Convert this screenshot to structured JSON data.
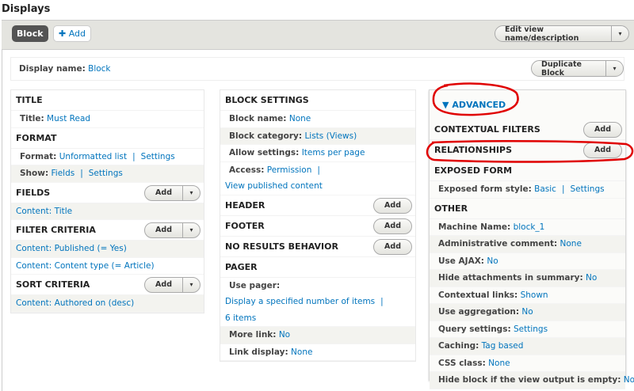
{
  "page_title": "Displays",
  "tabs": {
    "active": "Block",
    "add_plus": "✚",
    "add_label": "Add"
  },
  "edit_button": {
    "label": "Edit view name/description",
    "caret": "▾"
  },
  "display_name": {
    "label": "Display name:",
    "value": "Block"
  },
  "duplicate_button": {
    "label": "Duplicate Block",
    "caret": "▾"
  },
  "add_label": "Add",
  "advanced": {
    "arrow": "▼",
    "label": "ADVANCED"
  },
  "colors": {
    "link": "#0074bd",
    "annotation": "#e00000"
  },
  "columns": [
    {
      "sections": [
        {
          "title": "TITLE",
          "add": "none",
          "rows": [
            {
              "shade": false,
              "lines": [
                [
                  {
                    "k": "lab",
                    "t": "Title:"
                  },
                  {
                    "k": "lnk",
                    "t": "Must Read"
                  }
                ]
              ]
            }
          ]
        },
        {
          "title": "FORMAT",
          "add": "none",
          "rows": [
            {
              "shade": false,
              "lines": [
                [
                  {
                    "k": "lab",
                    "t": "Format:"
                  },
                  {
                    "k": "lnk",
                    "t": "Unformatted list"
                  },
                  {
                    "k": "sep",
                    "t": "|"
                  },
                  {
                    "k": "lnk",
                    "t": "Settings"
                  }
                ]
              ]
            },
            {
              "shade": true,
              "lines": [
                [
                  {
                    "k": "lab",
                    "t": "Show:"
                  },
                  {
                    "k": "lnk",
                    "t": "Fields"
                  },
                  {
                    "k": "sep",
                    "t": "|"
                  },
                  {
                    "k": "lnk",
                    "t": "Settings"
                  }
                ]
              ]
            }
          ]
        },
        {
          "title": "FIELDS",
          "add": "split",
          "rows": [
            {
              "shade": true,
              "lines": [
                [
                  {
                    "k": "lnk",
                    "t": "Content: Title"
                  }
                ]
              ]
            }
          ]
        },
        {
          "title": "FILTER CRITERIA",
          "add": "split",
          "rows": [
            {
              "shade": true,
              "lines": [
                [
                  {
                    "k": "lnk",
                    "t": "Content: Published (= Yes)"
                  }
                ]
              ]
            },
            {
              "shade": false,
              "lines": [
                [
                  {
                    "k": "lnk",
                    "t": "Content: Content type (= Article)"
                  }
                ]
              ]
            }
          ]
        },
        {
          "title": "SORT CRITERIA",
          "add": "split",
          "rows": [
            {
              "shade": true,
              "lines": [
                [
                  {
                    "k": "lnk",
                    "t": "Content: Authored on (desc)"
                  }
                ]
              ]
            }
          ]
        }
      ]
    },
    {
      "sections": [
        {
          "title": "BLOCK SETTINGS",
          "add": "none",
          "rows": [
            {
              "shade": false,
              "lines": [
                [
                  {
                    "k": "lab",
                    "t": "Block name:"
                  },
                  {
                    "k": "lnk",
                    "t": "None"
                  }
                ]
              ]
            },
            {
              "shade": true,
              "lines": [
                [
                  {
                    "k": "lab",
                    "t": "Block category:"
                  },
                  {
                    "k": "lnk",
                    "t": "Lists (Views)"
                  }
                ]
              ]
            },
            {
              "shade": false,
              "lines": [
                [
                  {
                    "k": "lab",
                    "t": "Allow settings:"
                  },
                  {
                    "k": "lnk",
                    "t": "Items per page"
                  }
                ]
              ]
            },
            {
              "shade": false,
              "lines": [
                [
                  {
                    "k": "lab",
                    "t": "Access:"
                  },
                  {
                    "k": "lnk",
                    "t": "Permission"
                  },
                  {
                    "k": "sep",
                    "t": "|"
                  }
                ],
                [
                  {
                    "k": "lnk",
                    "t": "View published content"
                  }
                ]
              ]
            }
          ]
        },
        {
          "title": "HEADER",
          "add": "simple",
          "rows": []
        },
        {
          "title": "FOOTER",
          "add": "simple",
          "rows": []
        },
        {
          "title": "NO RESULTS BEHAVIOR",
          "add": "simple",
          "rows": []
        },
        {
          "title": "PAGER",
          "add": "none",
          "rows": [
            {
              "shade": false,
              "lines": [
                [
                  {
                    "k": "lab",
                    "t": "Use pager:"
                  }
                ],
                [
                  {
                    "k": "lnk",
                    "t": "Display a specified number of items"
                  },
                  {
                    "k": "sep",
                    "t": "|"
                  }
                ],
                [
                  {
                    "k": "lnk",
                    "t": "6 items"
                  }
                ]
              ]
            },
            {
              "shade": true,
              "lines": [
                [
                  {
                    "k": "lab",
                    "t": "More link:"
                  },
                  {
                    "k": "lnk",
                    "t": "No"
                  }
                ]
              ]
            },
            {
              "shade": false,
              "lines": [
                [
                  {
                    "k": "lab",
                    "t": "Link display:"
                  },
                  {
                    "k": "lnk",
                    "t": "None"
                  }
                ]
              ]
            }
          ]
        }
      ]
    },
    {
      "sections": [
        {
          "title": "CONTEXTUAL FILTERS",
          "add": "simple",
          "rows": []
        },
        {
          "title": "RELATIONSHIPS",
          "add": "simple",
          "rows": []
        },
        {
          "title": "EXPOSED FORM",
          "add": "none",
          "rows": [
            {
              "shade": false,
              "lines": [
                [
                  {
                    "k": "lab",
                    "t": "Exposed form style:"
                  },
                  {
                    "k": "lnk",
                    "t": "Basic"
                  },
                  {
                    "k": "sep",
                    "t": "|"
                  },
                  {
                    "k": "lnk",
                    "t": "Settings"
                  }
                ]
              ]
            }
          ]
        },
        {
          "title": "OTHER",
          "add": "none",
          "rows": [
            {
              "shade": false,
              "lines": [
                [
                  {
                    "k": "lab",
                    "t": "Machine Name:"
                  },
                  {
                    "k": "lnk",
                    "t": "block_1"
                  }
                ]
              ]
            },
            {
              "shade": true,
              "lines": [
                [
                  {
                    "k": "lab",
                    "t": "Administrative comment:"
                  },
                  {
                    "k": "lnk",
                    "t": "None"
                  }
                ]
              ]
            },
            {
              "shade": false,
              "lines": [
                [
                  {
                    "k": "lab",
                    "t": "Use AJAX:"
                  },
                  {
                    "k": "lnk",
                    "t": "No"
                  }
                ]
              ]
            },
            {
              "shade": true,
              "lines": [
                [
                  {
                    "k": "lab",
                    "t": "Hide attachments in summary:"
                  },
                  {
                    "k": "lnk",
                    "t": "No"
                  }
                ]
              ]
            },
            {
              "shade": false,
              "lines": [
                [
                  {
                    "k": "lab",
                    "t": "Contextual links:"
                  },
                  {
                    "k": "lnk",
                    "t": "Shown"
                  }
                ]
              ]
            },
            {
              "shade": true,
              "lines": [
                [
                  {
                    "k": "lab",
                    "t": "Use aggregation:"
                  },
                  {
                    "k": "lnk",
                    "t": "No"
                  }
                ]
              ]
            },
            {
              "shade": false,
              "lines": [
                [
                  {
                    "k": "lab",
                    "t": "Query settings:"
                  },
                  {
                    "k": "lnk",
                    "t": "Settings"
                  }
                ]
              ]
            },
            {
              "shade": true,
              "lines": [
                [
                  {
                    "k": "lab",
                    "t": "Caching:"
                  },
                  {
                    "k": "lnk",
                    "t": "Tag based"
                  }
                ]
              ]
            },
            {
              "shade": false,
              "lines": [
                [
                  {
                    "k": "lab",
                    "t": "CSS class:"
                  },
                  {
                    "k": "lnk",
                    "t": "None"
                  }
                ]
              ]
            },
            {
              "shade": true,
              "lines": [
                [
                  {
                    "k": "lab",
                    "t": "Hide block if the view output is empty:"
                  },
                  {
                    "k": "lnk",
                    "t": "No"
                  }
                ]
              ]
            }
          ]
        }
      ]
    }
  ]
}
